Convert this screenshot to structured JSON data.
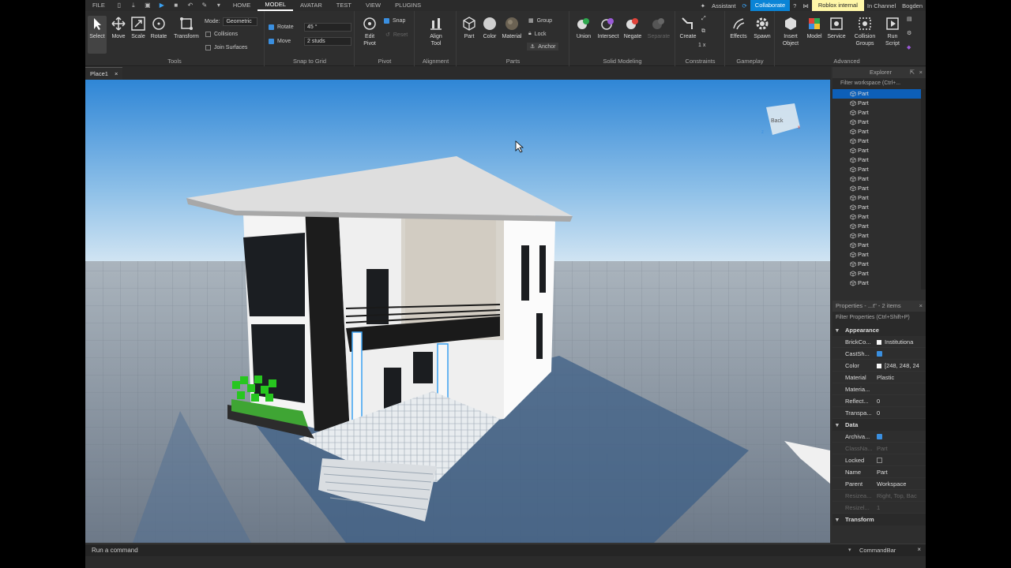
{
  "menu": {
    "file": "FILE",
    "tabs": [
      "HOME",
      "MODEL",
      "AVATAR",
      "TEST",
      "VIEW",
      "PLUGINS"
    ],
    "active_tab": "MODEL",
    "assistant": "Assistant",
    "collaborate": "Collaborate",
    "internal": "Roblox internal",
    "channel": "In Channel",
    "user": "Bogden"
  },
  "ribbon": {
    "tools": {
      "label": "Tools",
      "select": "Select",
      "move": "Move",
      "scale": "Scale",
      "rotate": "Rotate",
      "transform": "Transform",
      "mode_label": "Mode:",
      "mode_value": "Geometric",
      "collisions": "Collisions",
      "join_surfaces": "Join Surfaces"
    },
    "snap": {
      "label": "Snap to Grid",
      "rotate": "Rotate",
      "rotate_value": "45 °",
      "move": "Move",
      "move_value": "2 studs"
    },
    "pivot": {
      "label": "Pivot",
      "edit_pivot": "Edit Pivot",
      "snap": "Snap",
      "reset": "Reset"
    },
    "alignment": {
      "label": "Alignment",
      "align_tool": "Align Tool"
    },
    "parts": {
      "label": "Parts",
      "part": "Part",
      "color": "Color",
      "material": "Material",
      "group": "Group",
      "lock": "Lock",
      "anchor": "Anchor"
    },
    "solid": {
      "label": "Solid Modeling",
      "union": "Union",
      "intersect": "Intersect",
      "negate": "Negate",
      "separate": "Separate"
    },
    "constraints": {
      "label": "Constraints",
      "create": "Create",
      "scale_value": "1 x"
    },
    "gameplay": {
      "label": "Gameplay",
      "effects": "Effects",
      "spawn": "Spawn"
    },
    "advanced": {
      "label": "Advanced",
      "insert_object": "Insert Object",
      "model": "Model",
      "service": "Service",
      "collision_groups": "Collision Groups",
      "run_script": "Run Script"
    }
  },
  "document_tab": {
    "name": "Place1",
    "close": "×"
  },
  "viewport": {
    "view_cube_label": "Back"
  },
  "explorer": {
    "title": "Explorer",
    "filter_placeholder": "Filter workspace (Ctrl+...",
    "items": [
      "Part",
      "Part",
      "Part",
      "Part",
      "Part",
      "Part",
      "Part",
      "Part",
      "Part",
      "Part",
      "Part",
      "Part",
      "Part",
      "Part",
      "Part",
      "Part",
      "Part",
      "Part",
      "Part",
      "Part",
      "Part"
    ]
  },
  "properties": {
    "title": "Properties - ...t\" - 2 items",
    "filter_placeholder": "Filter Properties (Ctrl+Shift+P)",
    "sections": {
      "appearance": "Appearance",
      "data": "Data",
      "transform": "Transform"
    },
    "appearance_rows": [
      {
        "name": "BrickCo...",
        "value": "Institutiona"
      },
      {
        "name": "CastSh...",
        "value": ""
      },
      {
        "name": "Color",
        "value": "[248, 248, 24"
      },
      {
        "name": "Material",
        "value": "Plastic"
      },
      {
        "name": "Materia...",
        "value": ""
      },
      {
        "name": "Reflect...",
        "value": "0"
      },
      {
        "name": "Transpa...",
        "value": "0"
      }
    ],
    "data_rows": [
      {
        "name": "Archiva...",
        "value": ""
      },
      {
        "name": "ClassNa...",
        "value": "Part"
      },
      {
        "name": "Locked",
        "value": ""
      },
      {
        "name": "Name",
        "value": "Part"
      },
      {
        "name": "Parent",
        "value": "Workspace"
      },
      {
        "name": "Resizea...",
        "value": "Right, Top, Bac"
      },
      {
        "name": "Resizel...",
        "value": "1"
      }
    ]
  },
  "command_bar": {
    "placeholder": "Run a command",
    "label": "CommandBar"
  },
  "colors": {
    "accent": "#0a84d6",
    "selection": "#0d5fb8",
    "sky_top": "#3a8ed8",
    "sky_bottom": "#bcd8ee",
    "ground": "#7c8794"
  }
}
